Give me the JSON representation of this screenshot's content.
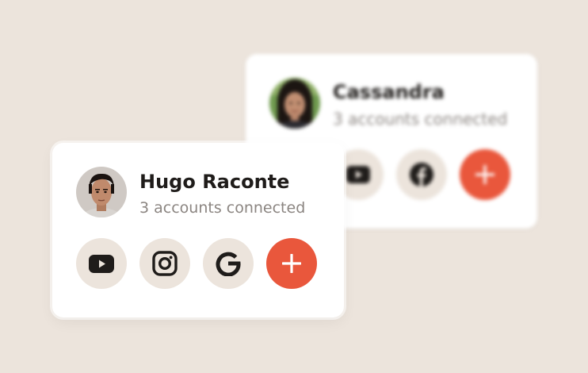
{
  "colors": {
    "background": "#ece4dc",
    "card": "#ffffff",
    "icon_button_bg": "#ece4dc",
    "accent": "#e9573c",
    "name_text": "#1f1c1a",
    "subtitle_text": "#8b8581"
  },
  "back_card": {
    "name": "Cassandra",
    "subtitle": "3 accounts connected",
    "buttons": [
      {
        "icon": "youtube-icon"
      },
      {
        "icon": "facebook-icon"
      },
      {
        "icon": "plus-icon"
      }
    ]
  },
  "front_card": {
    "name": "Hugo Raconte",
    "subtitle": "3 accounts connected",
    "buttons": [
      {
        "icon": "youtube-icon"
      },
      {
        "icon": "instagram-icon"
      },
      {
        "icon": "google-icon"
      },
      {
        "icon": "plus-icon"
      }
    ]
  }
}
